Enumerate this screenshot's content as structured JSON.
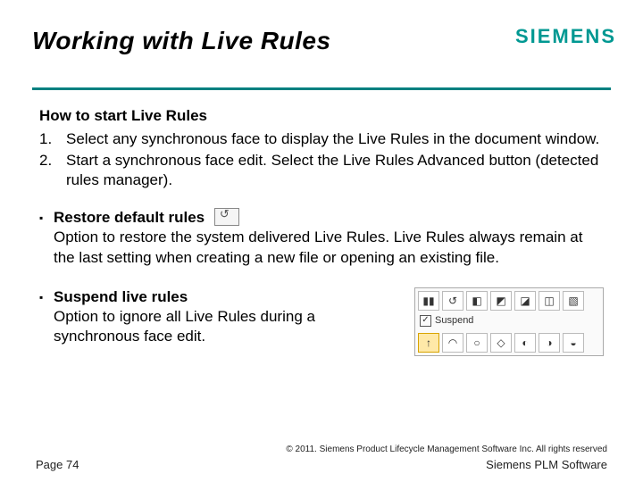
{
  "brand": "SIEMENS",
  "title": "Working with Live Rules",
  "section_title": "How to start Live Rules",
  "steps": [
    {
      "n": "1.",
      "text": "Select any synchronous face to display the Live Rules in the document window."
    },
    {
      "n": "2.",
      "text": "Start a synchronous face edit. Select the Live Rules Advanced button (detected rules manager)."
    }
  ],
  "bullets": [
    {
      "title": "Restore default rules",
      "icon": "restore-icon",
      "text": "Option to restore the system delivered Live Rules. Live Rules always remain at the last setting when creating a new file or opening an existing file."
    },
    {
      "title": "Suspend live rules",
      "text": "Option to ignore all Live Rules during a synchronous face edit.",
      "toolbar": {
        "suspend_label": "Suspend",
        "checked": true
      }
    }
  ],
  "footer": {
    "copyright": "© 2011. Siemens Product Lifecycle Management Software Inc. All rights reserved",
    "page": "Page 74",
    "product": "Siemens PLM Software"
  }
}
